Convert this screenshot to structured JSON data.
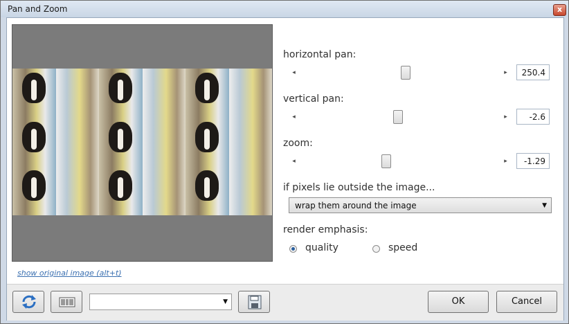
{
  "window": {
    "title": "Pan and Zoom",
    "close_label": "x"
  },
  "preview": {
    "image": "dog-photo-tiled"
  },
  "controls": {
    "horizontal": {
      "label": "horizontal pan:",
      "value": "250.4",
      "position": 0.53
    },
    "vertical": {
      "label": "vertical pan:",
      "value": "-2.6",
      "position": 0.49
    },
    "zoom": {
      "label": "zoom:",
      "value": "-1.29",
      "position": 0.43
    },
    "outside": {
      "label": "if pixels lie outside the image...",
      "selected": "wrap them around the image"
    },
    "emphasis": {
      "label": "render emphasis:",
      "options": [
        "quality",
        "speed"
      ],
      "selected": "quality"
    }
  },
  "show_original_link": "show original image (alt+t)",
  "footer": {
    "reset_icon": "refresh-icon",
    "randomize_icon": "barcode-icon",
    "save_icon": "floppy-disk-icon",
    "preset_value": "",
    "ok_label": "OK",
    "cancel_label": "Cancel"
  },
  "colors": {
    "accent": "#2a5f9e",
    "link": "#3a6fb0",
    "titlebar": "#cfd9e6"
  }
}
